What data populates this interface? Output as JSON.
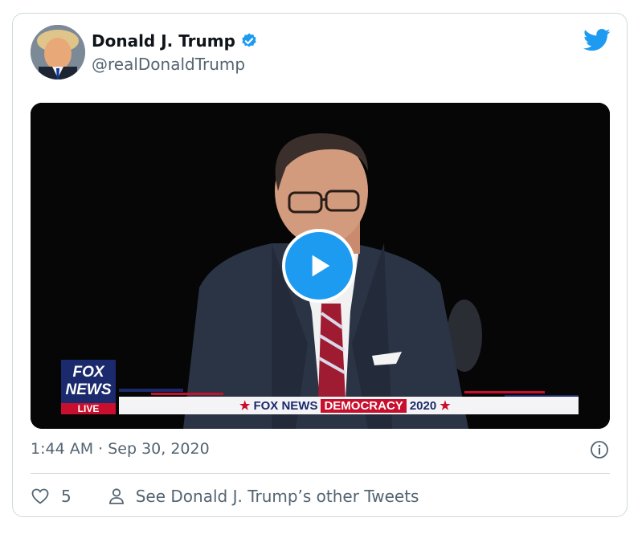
{
  "tweet": {
    "author_name": "Donald J. Trump",
    "handle": "@realDonaldTrump",
    "timestamp": "1:44 AM · Sep 30, 2020",
    "like_count": "5",
    "see_other_tweets": "See Donald J. Trump’s other Tweets"
  },
  "video": {
    "logo_line1": "FOX",
    "logo_line2": "NEWS",
    "logo_line3": "LIVE",
    "banner_fox": "FOX NEWS",
    "banner_democracy": "DEMOCRACY",
    "banner_year": "2020"
  },
  "icons": {
    "verified": "verified-badge-icon",
    "twitter": "twitter-bird-icon",
    "play": "play-icon",
    "info": "info-icon",
    "like": "heart-icon",
    "profile": "person-icon"
  },
  "colors": {
    "brand_blue": "#1d9bf0",
    "text_secondary": "#536471",
    "border": "#cfd9de",
    "fox_red": "#c8102e",
    "fox_blue": "#1a2a6c"
  }
}
